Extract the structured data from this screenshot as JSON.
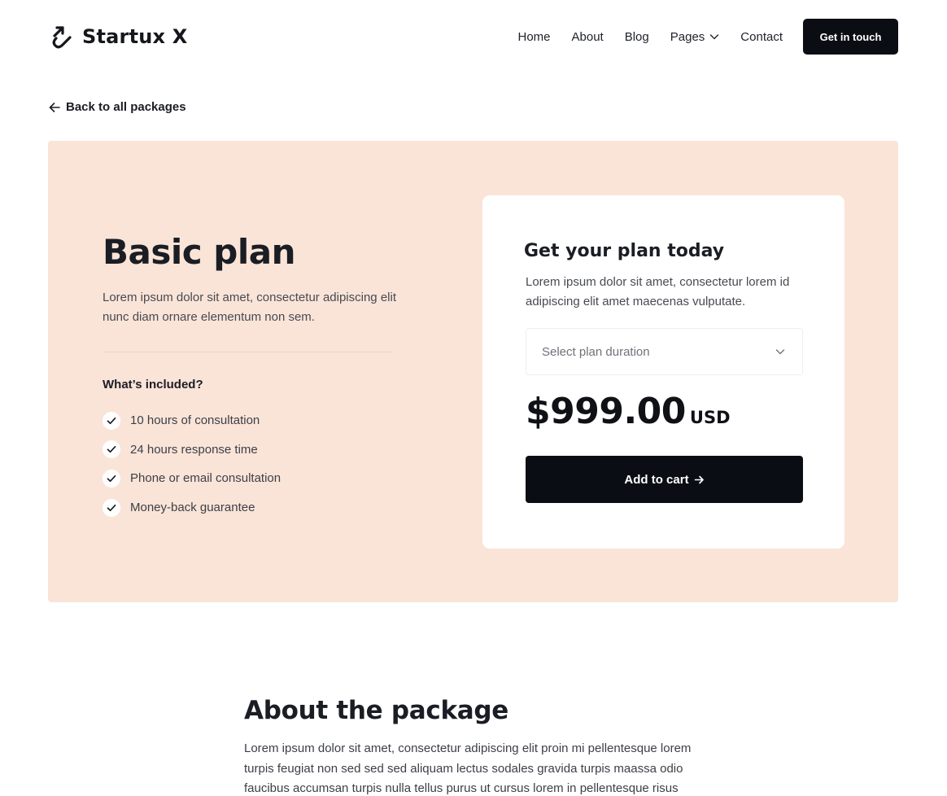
{
  "header": {
    "brand": "Startux X",
    "nav": {
      "home": "Home",
      "about": "About",
      "blog": "Blog",
      "pages": "Pages",
      "contact": "Contact"
    },
    "cta": "Get in touch"
  },
  "back_link": "Back to all packages",
  "plan": {
    "title": "Basic plan",
    "description": "Lorem ipsum dolor sit amet, consectetur adipiscing elit nunc diam ornare elementum non sem.",
    "included_title": "What’s included?",
    "features": [
      "10 hours of consultation",
      "24 hours response time",
      "Phone or email consultation",
      "Money-back guarantee"
    ]
  },
  "card": {
    "title": "Get your plan today",
    "description": "Lorem ipsum dolor sit amet, consectetur lorem id adipiscing elit amet maecenas vulputate.",
    "select_placeholder": "Select plan duration",
    "price": "$999.00",
    "currency": "USD",
    "add_to_cart": "Add to cart"
  },
  "about": {
    "title": "About the package",
    "text": "Lorem ipsum dolor sit amet, consectetur adipiscing elit proin mi pellentesque  lorem turpis feugiat non sed sed sed aliquam lectus sodales gravida turpis maassa odio faucibus accumsan turpis nulla tellus purus ut   cursus lorem  in pellentesque risus"
  },
  "colors": {
    "hero_background": "#fae4d8",
    "dark_button": "#0a0e14",
    "text_primary": "#1b1d24"
  },
  "icons": {
    "brand": "startux-logo-icon",
    "back": "arrow-left-icon",
    "pages_dropdown": "chevron-down-icon",
    "feature": "check-icon",
    "select": "chevron-down-icon",
    "add_to_cart": "arrow-right-icon"
  }
}
